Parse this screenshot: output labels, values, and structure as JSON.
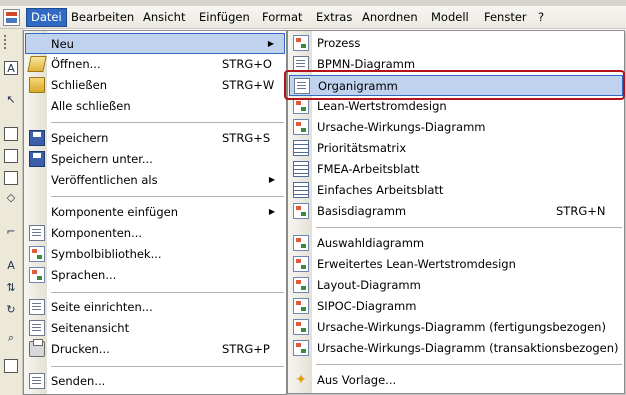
{
  "menubar": {
    "items": [
      {
        "label": "Datei",
        "active": true
      },
      {
        "label": "Bearbeiten"
      },
      {
        "label": "Ansicht"
      },
      {
        "label": "Einfügen"
      },
      {
        "label": "Format"
      },
      {
        "label": "Extras"
      },
      {
        "label": "Anordnen"
      },
      {
        "label": "Modell"
      },
      {
        "label": "Fenster"
      },
      {
        "label": "?"
      }
    ]
  },
  "file_menu": {
    "items": [
      {
        "label": "Neu",
        "shortcut": "",
        "submenu": true,
        "icon": "none"
      },
      {
        "label": "Öffnen...",
        "shortcut": "STRG+O",
        "icon": "open-folder-icon"
      },
      {
        "label": "Schließen",
        "shortcut": "STRG+W",
        "icon": "folder-icon"
      },
      {
        "label": "Alle schließen",
        "shortcut": "",
        "icon": "none"
      },
      {
        "label": "Speichern",
        "shortcut": "STRG+S",
        "icon": "save-disk-icon"
      },
      {
        "label": "Speichern unter...",
        "shortcut": "",
        "icon": "save-as-icon"
      },
      {
        "label": "Veröffentlichen als",
        "shortcut": "",
        "submenu": true,
        "icon": "none"
      },
      {
        "label": "Komponente einfügen",
        "shortcut": "",
        "submenu": true,
        "icon": "none"
      },
      {
        "label": "Komponenten...",
        "shortcut": "",
        "icon": "components-icon"
      },
      {
        "label": "Symbolbibliothek...",
        "shortcut": "",
        "icon": "symbol-library-icon"
      },
      {
        "label": "Sprachen...",
        "shortcut": "",
        "icon": "languages-icon"
      },
      {
        "label": "Seite einrichten...",
        "shortcut": "",
        "icon": "page-setup-icon"
      },
      {
        "label": "Seitenansicht",
        "shortcut": "",
        "icon": "page-preview-icon"
      },
      {
        "label": "Drucken...",
        "shortcut": "STRG+P",
        "icon": "printer-icon"
      },
      {
        "label": "Senden...",
        "shortcut": "",
        "icon": "send-icon"
      }
    ]
  },
  "new_submenu": {
    "items": [
      {
        "label": "Prozess",
        "shortcut": "",
        "icon": "process-diagram-icon"
      },
      {
        "label": "BPMN-Diagramm",
        "shortcut": "",
        "icon": "bpmn-diagram-icon"
      },
      {
        "label": "Organigramm",
        "shortcut": "",
        "icon": "org-chart-icon",
        "highlighted": true
      },
      {
        "label": "Lean-Wertstromdesign",
        "shortcut": "",
        "icon": "value-stream-icon"
      },
      {
        "label": "Ursache-Wirkungs-Diagramm",
        "shortcut": "",
        "icon": "cause-effect-icon"
      },
      {
        "label": "Prioritätsmatrix",
        "shortcut": "",
        "icon": "matrix-table-icon"
      },
      {
        "label": "FMEA-Arbeitsblatt",
        "shortcut": "",
        "icon": "worksheet-table-icon"
      },
      {
        "label": "Einfaches Arbeitsblatt",
        "shortcut": "",
        "icon": "simple-worksheet-icon"
      },
      {
        "label": "Basisdiagramm",
        "shortcut": "STRG+N",
        "icon": "basic-diagram-icon"
      },
      {
        "label": "Auswahldiagramm",
        "shortcut": "",
        "icon": "selection-diagram-icon"
      },
      {
        "label": "Erweitertes Lean-Wertstromdesign",
        "shortcut": "",
        "icon": "extended-value-stream-icon"
      },
      {
        "label": "Layout-Diagramm",
        "shortcut": "",
        "icon": "layout-diagram-icon"
      },
      {
        "label": "SIPOC-Diagramm",
        "shortcut": "",
        "icon": "sipoc-diagram-icon"
      },
      {
        "label": "Ursache-Wirkungs-Diagramm (fertigungsbezogen)",
        "shortcut": "",
        "icon": "cause-effect-manufacturing-icon"
      },
      {
        "label": "Ursache-Wirkungs-Diagramm (transaktionsbezogen)",
        "shortcut": "",
        "icon": "cause-effect-transaction-icon"
      },
      {
        "label": "Aus Vorlage...",
        "shortcut": "",
        "icon": "template-icon"
      }
    ]
  },
  "colors": {
    "menu_highlight": "#316ac5",
    "item_highlight_bg": "#c1d2ee",
    "annotation_red": "#b4131b"
  }
}
